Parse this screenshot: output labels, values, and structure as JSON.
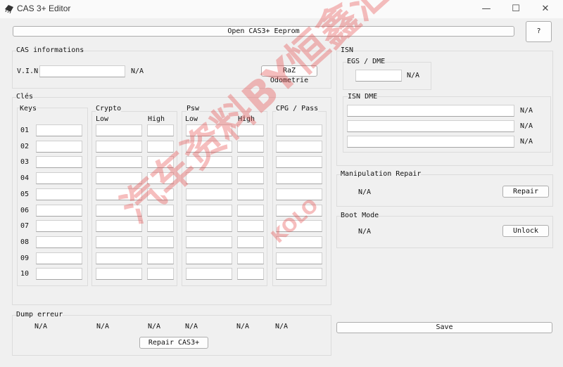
{
  "window": {
    "title": "CAS 3+ Editor",
    "min": "—",
    "max": "☐",
    "close": "✕"
  },
  "toolbar": {
    "open_label": "Open CAS3+ Eeprom",
    "help_label": "?"
  },
  "cas_info": {
    "title": "CAS informations",
    "vin_label": "V.I.N",
    "vin_value": "",
    "vin_status": "N/A",
    "raz_label": "RaZ Odometrie"
  },
  "cles": {
    "title": "Clés",
    "keys_label": "Keys",
    "crypto_label": "Crypto",
    "psw_label": "Psw",
    "cpg_label": "CPG / Pass",
    "low_label": "Low",
    "high_label": "High",
    "rows": [
      "01",
      "02",
      "03",
      "04",
      "05",
      "06",
      "07",
      "08",
      "09",
      "10"
    ]
  },
  "dump": {
    "title": "Dump erreur",
    "values": [
      "N/A",
      "N/A",
      "N/A",
      "N/A",
      "N/A",
      "N/A"
    ],
    "repair_label": "Repair CAS3+"
  },
  "isn": {
    "title": "ISN",
    "egs_title": "EGS / DME",
    "egs_status": "N/A",
    "dme_title": "ISN DME",
    "dme_statuses": [
      "N/A",
      "N/A",
      "N/A"
    ]
  },
  "manip": {
    "title": "Manipulation Repair",
    "status": "N/A",
    "button": "Repair"
  },
  "boot": {
    "title": "Boot Mode",
    "status": "N/A",
    "button": "Unlock"
  },
  "save_label": "Save",
  "watermark": {
    "text": "汽车资料BY恒鑫汇",
    "text2": "KOLO"
  }
}
